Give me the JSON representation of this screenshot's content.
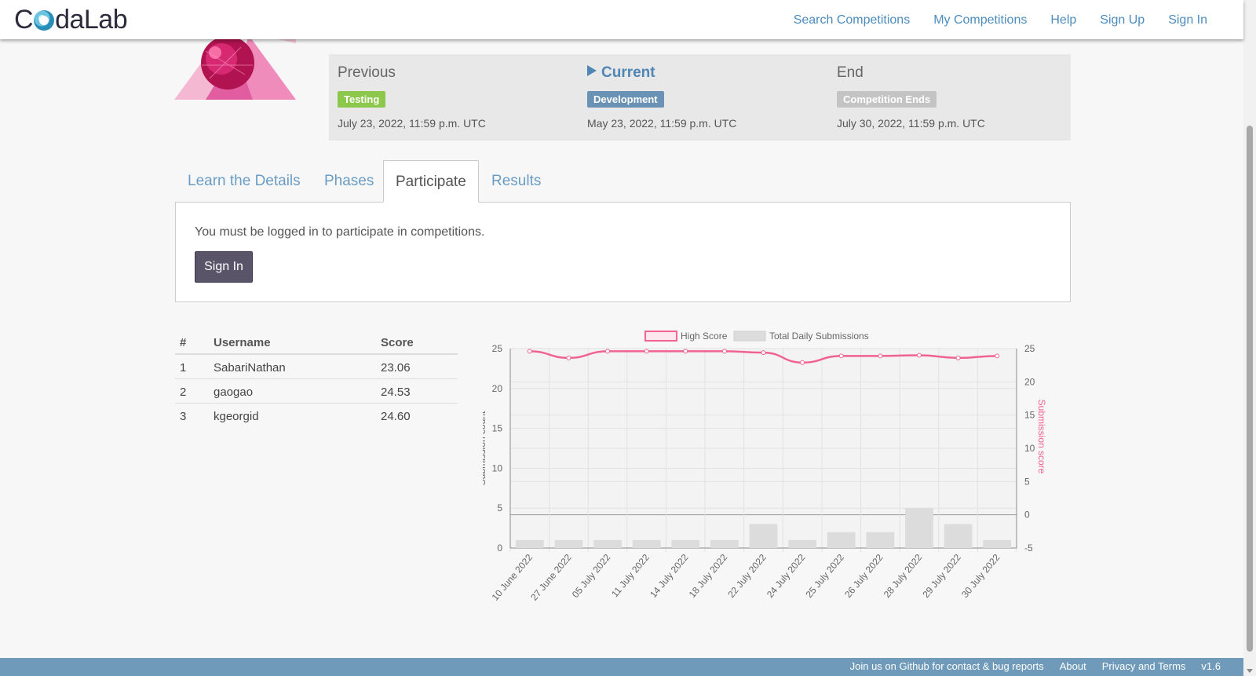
{
  "navbar": {
    "logo_text_pre": "C",
    "logo_text_post": "daLab",
    "links": [
      "Search Competitions",
      "My Competitions",
      "Help",
      "Sign Up",
      "Sign In"
    ]
  },
  "phases": {
    "previous": {
      "label": "Previous",
      "badge": "Testing",
      "date": "July 23, 2022, 11:59 p.m. UTC"
    },
    "current": {
      "label": "Current",
      "badge": "Development",
      "date": "May 23, 2022, 11:59 p.m. UTC"
    },
    "end": {
      "label": "End",
      "badge": "Competition Ends",
      "date": "July 30, 2022, 11:59 p.m. UTC"
    }
  },
  "tabs": [
    "Learn the Details",
    "Phases",
    "Participate",
    "Results"
  ],
  "panel": {
    "message": "You must be logged in to participate in competitions.",
    "button": "Sign In"
  },
  "leaderboard": {
    "headers": [
      "#",
      "Username",
      "Score"
    ],
    "rows": [
      [
        "1",
        "SabariNathan",
        "23.06"
      ],
      [
        "2",
        "gaogao",
        "24.53"
      ],
      [
        "3",
        "kgeorgid",
        "24.60"
      ]
    ]
  },
  "chart_data": {
    "type": "bar",
    "categories": [
      "10 June 2022",
      "27 June 2022",
      "05 July 2022",
      "11 July 2022",
      "14 July 2022",
      "18 July 2022",
      "22 July 2022",
      "24 July 2022",
      "25 July 2022",
      "26 July 2022",
      "28 July 2022",
      "29 July 2022",
      "30 July 2022"
    ],
    "series": [
      {
        "name": "Total Daily Submissions",
        "type": "bar",
        "axis": "left",
        "color": "#dcdcdc",
        "values": [
          1,
          1,
          1,
          1,
          1,
          1,
          3,
          1,
          2,
          2,
          5,
          3,
          1
        ]
      },
      {
        "name": "High Score",
        "type": "line",
        "axis": "right",
        "color": "#f06292",
        "values": [
          24.6,
          23.6,
          24.6,
          24.6,
          24.6,
          24.6,
          24.4,
          22.9,
          23.9,
          23.9,
          24.0,
          23.6,
          23.9
        ]
      }
    ],
    "ylabel": "Submission count",
    "y2label": "Submission score",
    "ylim": [
      0,
      25
    ],
    "y2lim": [
      -5,
      25
    ],
    "yticks": [
      0,
      5,
      10,
      15,
      20,
      25
    ],
    "y2ticks": [
      -5,
      0,
      5,
      10,
      15,
      20,
      25
    ],
    "grid": true,
    "legend": "top-center"
  },
  "footer": {
    "links": [
      "Join us on Github for contact & bug reports",
      "About",
      "Privacy and Terms",
      "v1.6"
    ]
  }
}
